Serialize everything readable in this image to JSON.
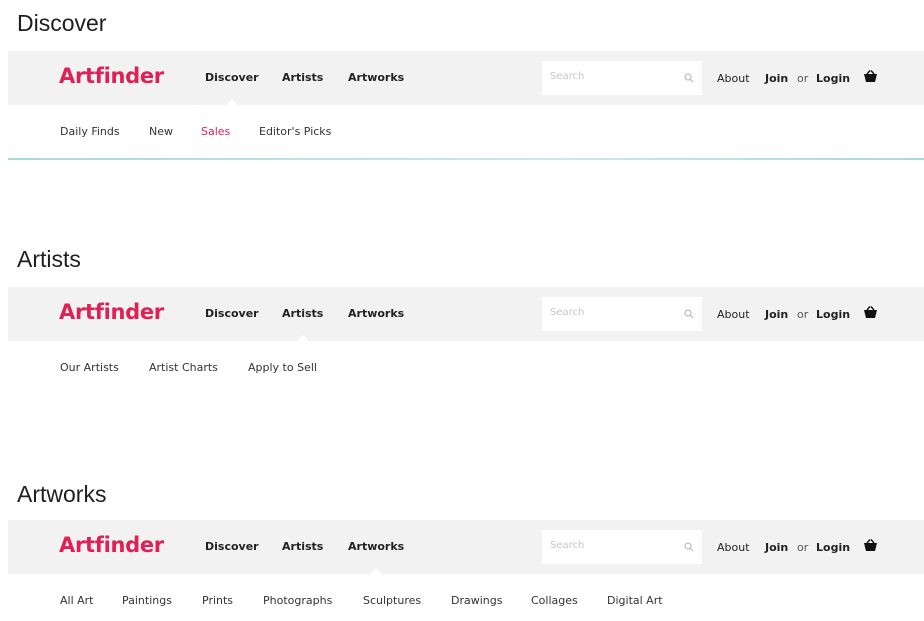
{
  "brand": {
    "name": "Artfinder",
    "accent_color": "#e01f54"
  },
  "sections": [
    {
      "title": "Discover",
      "nav": [
        "Discover",
        "Artists",
        "Artworks"
      ],
      "active_nav": "Discover",
      "search_placeholder": "Search",
      "about": "About",
      "join": "Join",
      "or": "or",
      "login": "Login",
      "subnav": [
        "Daily Finds",
        "New",
        "Sales",
        "Editor's Picks"
      ],
      "active_subnav": "Sales"
    },
    {
      "title": "Artists",
      "nav": [
        "Discover",
        "Artists",
        "Artworks"
      ],
      "active_nav": "Artists",
      "search_placeholder": "Search",
      "about": "About",
      "join": "Join",
      "or": "or",
      "login": "Login",
      "subnav": [
        "Our Artists",
        "Artist Charts",
        "Apply to Sell"
      ]
    },
    {
      "title": "Artworks",
      "nav": [
        "Discover",
        "Artists",
        "Artworks"
      ],
      "active_nav": "Artworks",
      "search_placeholder": "Search",
      "about": "About",
      "join": "Join",
      "or": "or",
      "login": "Login",
      "subnav": [
        "All Art",
        "Paintings",
        "Prints",
        "Photographs",
        "Sculptures",
        "Drawings",
        "Collages",
        "Digital Art"
      ]
    }
  ],
  "icons": {
    "search": "search-icon",
    "cart": "basket-icon"
  }
}
